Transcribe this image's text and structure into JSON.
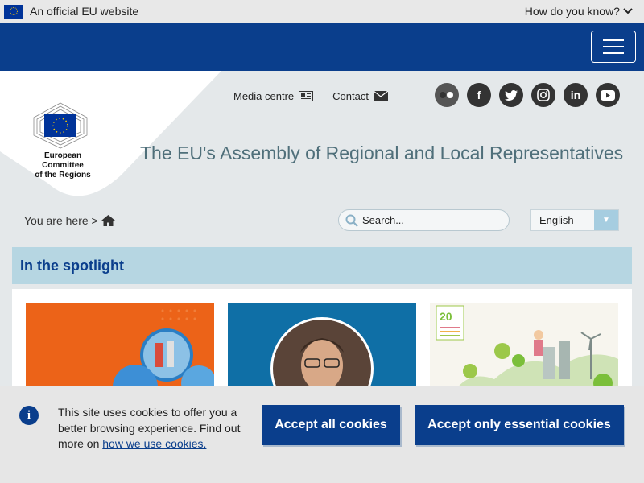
{
  "eu_bar": {
    "official_text": "An official EU website",
    "how_know": "How do you know?"
  },
  "header": {
    "menu_label": ""
  },
  "logo": {
    "org_line1": "European Committee",
    "org_line2": "of the Regions"
  },
  "top_links": {
    "media_centre": "Media centre",
    "contact": "Contact"
  },
  "socials": [
    "flickr",
    "facebook",
    "twitter",
    "instagram",
    "linkedin",
    "youtube"
  ],
  "site_title": "The EU's Assembly of Regional and Local Representatives",
  "breadcrumb": {
    "prefix": "You are here >"
  },
  "search": {
    "placeholder": "Search..."
  },
  "language": {
    "selected": "English"
  },
  "spotlight": {
    "title": "In the spotlight"
  },
  "cookie_banner": {
    "text": "This site uses cookies to offer you a better browsing experience. Find out more on ",
    "link": "how we use cookies.",
    "accept_all": "Accept all cookies",
    "accept_essential": "Accept only essential cookies"
  },
  "colors": {
    "eu_blue": "#0a3e8c",
    "spotlight_bg": "#b6d6e2",
    "card_orange": "#ec6318",
    "card_blue": "#0f6fa6"
  }
}
